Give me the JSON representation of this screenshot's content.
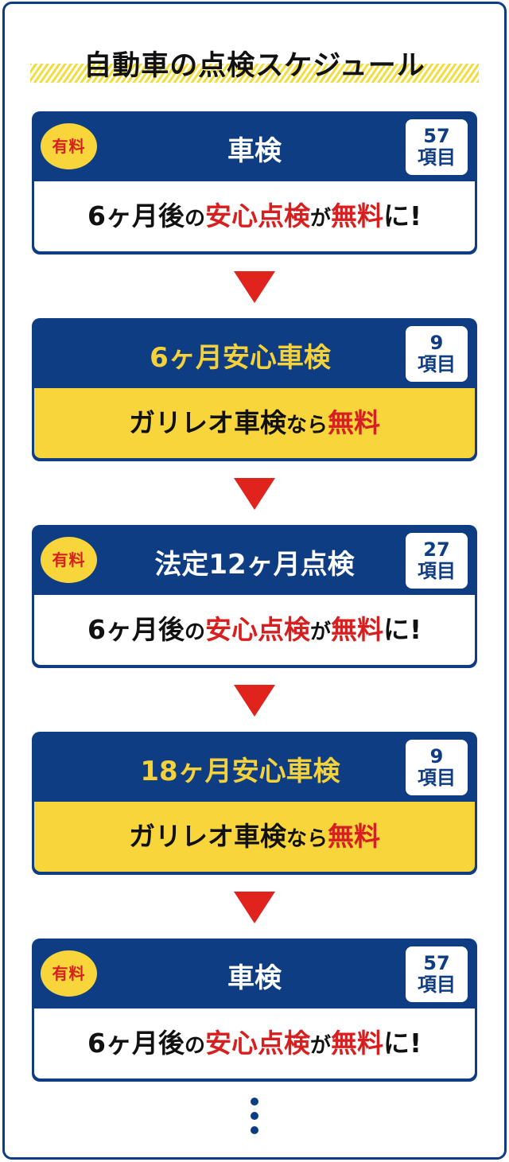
{
  "title": "自動車の点検スケジュール",
  "colors": {
    "navy": "#0f3d83",
    "yellow": "#f8d53b",
    "red": "#d71f1f",
    "arrow_red": "#e0231d"
  },
  "cards": [
    {
      "paid_label": "有料",
      "title": "車検",
      "count_number": "57",
      "count_unit": "項目",
      "body": {
        "p1": "6ヶ月後",
        "p2": "の",
        "p3": "安心点検",
        "p4": "が",
        "p5": "無料",
        "p6": "に!"
      }
    },
    {
      "title": "6ヶ月安心車検",
      "count_number": "9",
      "count_unit": "項目",
      "body": {
        "p1": "ガリレオ車検",
        "p2": "なら",
        "p3": "無料"
      }
    },
    {
      "paid_label": "有料",
      "title": "法定12ヶ月点検",
      "count_number": "27",
      "count_unit": "項目",
      "body": {
        "p1": "6ヶ月後",
        "p2": "の",
        "p3": "安心点検",
        "p4": "が",
        "p5": "無料",
        "p6": "に!"
      }
    },
    {
      "title": "18ヶ月安心車検",
      "count_number": "9",
      "count_unit": "項目",
      "body": {
        "p1": "ガリレオ車検",
        "p2": "なら",
        "p3": "無料"
      }
    },
    {
      "paid_label": "有料",
      "title": "車検",
      "count_number": "57",
      "count_unit": "項目",
      "body": {
        "p1": "6ヶ月後",
        "p2": "の",
        "p3": "安心点検",
        "p4": "が",
        "p5": "無料",
        "p6": "に!"
      }
    }
  ],
  "continuation_icon": "vertical-ellipsis-icon"
}
